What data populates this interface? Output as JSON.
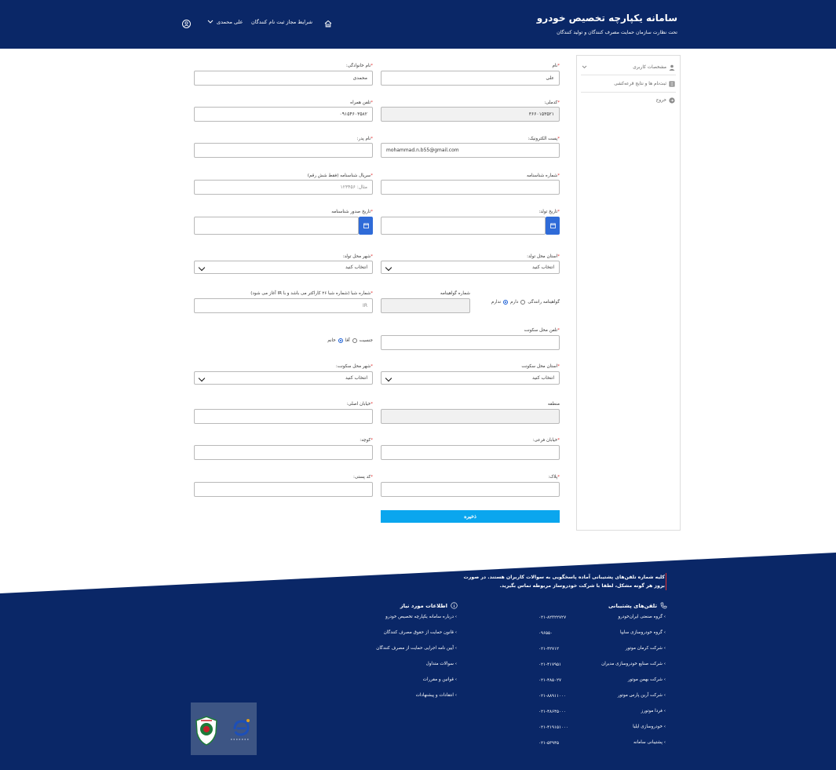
{
  "header": {
    "title": "سامانه یکپارچه تخصیص خودرو",
    "subtitle": "تحت نظارت سازمان حمایت مصرف کنندگان و تولید کنندگان",
    "nav_regs": "شرایط مجاز ثبت نام کنندگان",
    "nav_user": "علی محمدی"
  },
  "sidebar": {
    "items": [
      {
        "label": "مشخصات کاربری"
      },
      {
        "label": "ثبت‌نام ها و نتایج قرعه‌کشی"
      },
      {
        "label": "خروج"
      }
    ]
  },
  "form": {
    "fields": {
      "first_name": {
        "label": "نام",
        "value": "علی"
      },
      "last_name": {
        "label": "نام خانوادگی",
        "value": "محمدی"
      },
      "national_code": {
        "label": "کدملی",
        "value": "۳۶۶۰۱۵۳۵۲۱"
      },
      "mobile": {
        "label": "تلفن همراه",
        "value": "۰۹۱۵۴۶۰۳۵۸۲"
      },
      "email": {
        "label": "پست الکترونیک",
        "value": "mohammad.n.b55@gmail.com"
      },
      "father_name": {
        "label": "نام پدر",
        "value": ""
      },
      "id_number": {
        "label": "شماره شناسنامه",
        "value": ""
      },
      "id_serial": {
        "label": "سریال شناسنامه (فقط شش رقم)",
        "placeholder": "مثال: ۱۲۳۴۵۶"
      },
      "birth_date": {
        "label": "تاریخ تولد",
        "value": ""
      },
      "id_issue_date": {
        "label": "تاریخ صدور شناسنامه",
        "value": ""
      },
      "birth_province": {
        "label": "استان محل تولد",
        "value": "انتخاب کنید"
      },
      "birth_city": {
        "label": "شهر محل تولد",
        "value": "انتخاب کنید"
      },
      "license_label": "گواهینامه رانندگی",
      "license_has": "دارم",
      "license_hasnot": "ندارم",
      "license_number": {
        "label": "شماره گواهینامه",
        "value": ""
      },
      "sheba": {
        "label": "شماره شبا (شماره شبا ۲۶ کاراکتر می باشد و با IR آغاز می شود)",
        "placeholder": "IR"
      },
      "residence_phone": {
        "label": "تلفن محل سکونت",
        "value": ""
      },
      "gender_label": "جنسیت",
      "gender_male": "آقا",
      "gender_female": "خانم",
      "residence_province": {
        "label": "استان محل سکونت",
        "value": "انتخاب کنید"
      },
      "residence_city": {
        "label": "شهر محل سکونت",
        "value": "انتخاب کنید"
      },
      "region": {
        "label": "منطقه",
        "value": ""
      },
      "main_street": {
        "label": "خیابان اصلی",
        "value": ""
      },
      "side_street": {
        "label": "خیابان فرعی",
        "value": ""
      },
      "alley": {
        "label": "کوچه",
        "value": ""
      },
      "plaque": {
        "label": "پلاک",
        "value": ""
      },
      "postal_code": {
        "label": "کد پستی",
        "value": ""
      }
    },
    "save_label": "ذخیره"
  },
  "footer": {
    "note": "کلیه شماره تلفن‌های پشتیبانی آماده پاسخگویی به سوالات کاربران هستند. در صورت بروز هر گونه مشکل، لطفا با شرکت خودروساز مربوطه تماس بگیرید.",
    "support_title": "تلفن‌های پشتیبانی",
    "info_title": "اطلاعات مورد نیاز",
    "support": [
      {
        "name": "گروه صنعتی ایران‌خودرو",
        "phone": "۰۲۱-۸۲۳۲۲۷۲۷"
      },
      {
        "name": "گروه خودروسازی سایپا",
        "phone": "۰۹۶۵۵۰"
      },
      {
        "name": "شرکت کرمان موتور",
        "phone": "۰۲۱-۴۲۷۱۲"
      },
      {
        "name": "شرکت صنایع خودروسازی مدیران",
        "phone": "۰۲۱-۴۱۷۹۵۱"
      },
      {
        "name": "شرکت بهمن موتور",
        "phone": "۰۲۱-۴۸۵۰۲۷"
      },
      {
        "name": "شرکت آرین پارس موتور",
        "phone": "۰۲۱-۸۸۹۱۱۰۰۰"
      },
      {
        "name": "فردا موتورز",
        "phone": "۰۲۱-۴۸۶۴۵۰۰۰"
      },
      {
        "name": "خودروسازی ایلیا",
        "phone": "۰۲۱-۴۱۹۱۵۱۰۰۰"
      },
      {
        "name": "پشتیبانی سامانه",
        "phone": "۰۲۱-۵۳۹۴۵"
      }
    ],
    "info": [
      "درباره سامانه یکپارچه تخصیص خودرو",
      "قانون حمایت از حقوق مصرف کنندگان",
      "آیین نامه اجرایی حمایت از مصرف کنندگان",
      "سوالات متداول",
      "قوانین و مقررات",
      "انتقادات و پیشنهادات"
    ]
  }
}
